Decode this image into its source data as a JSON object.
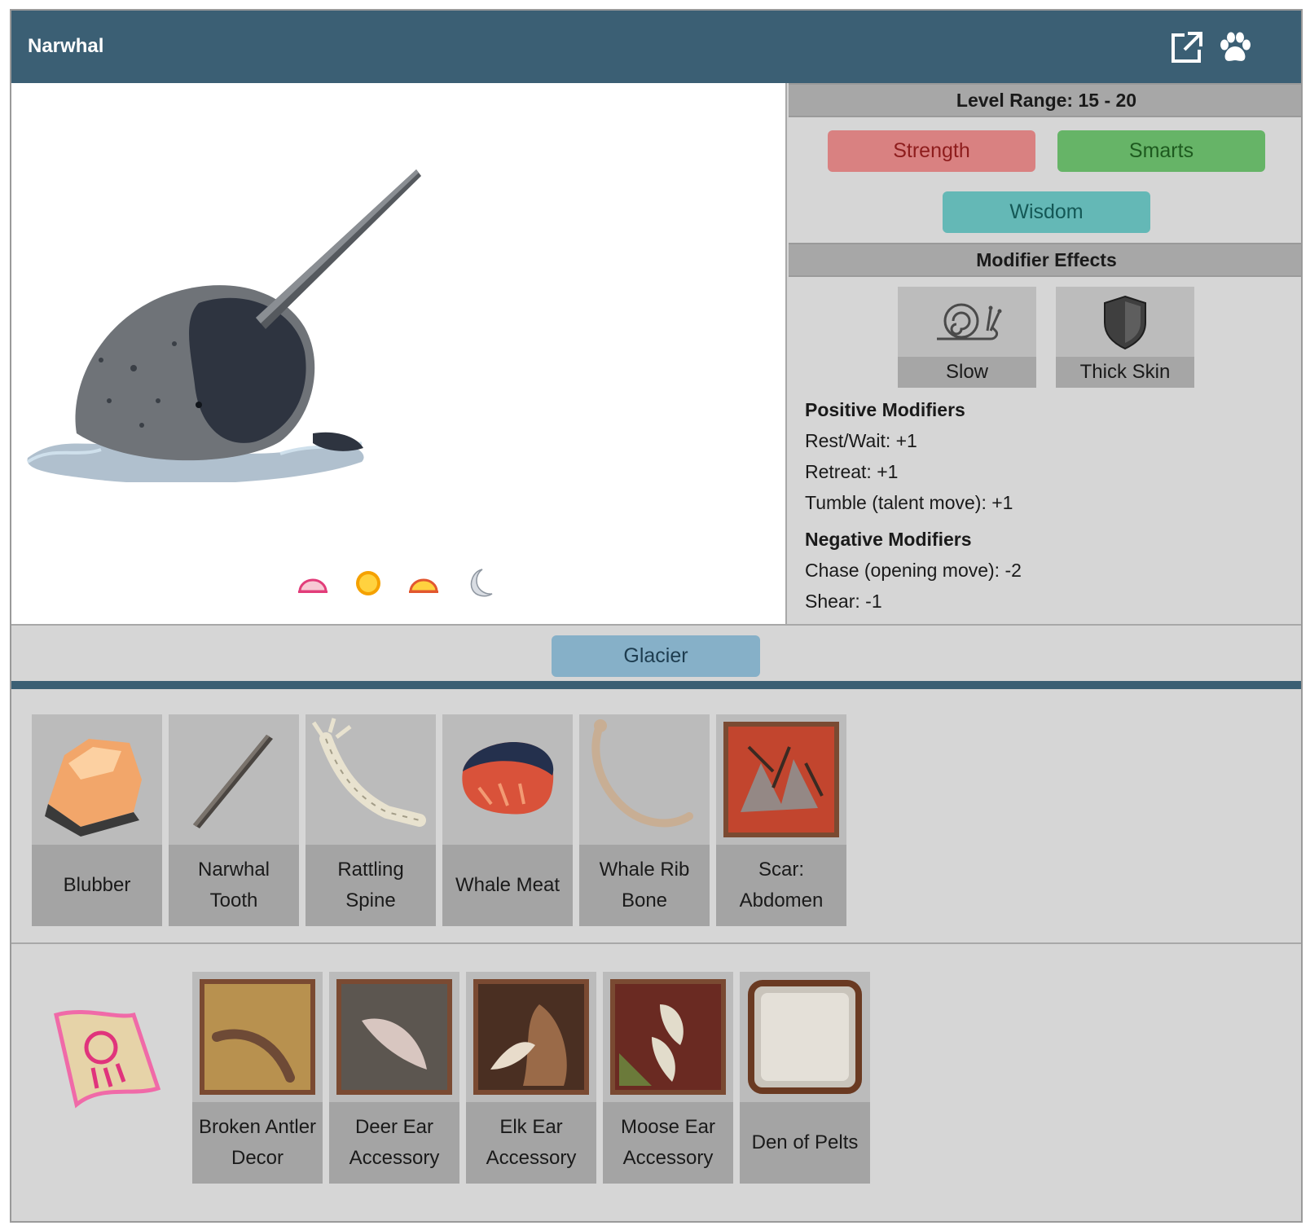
{
  "header": {
    "title": "Narwhal",
    "icons": [
      "external-link-icon",
      "paw-icon"
    ]
  },
  "times": [
    "dawn-icon",
    "day-icon",
    "dusk-icon",
    "night-icon"
  ],
  "level": {
    "label": "Level Range: 15 - 20"
  },
  "stats": {
    "strength": "Strength",
    "smarts": "Smarts",
    "wisdom": "Wisdom"
  },
  "modifier_effects": {
    "heading": "Modifier Effects",
    "effects": [
      {
        "label": "Slow",
        "icon": "snail-icon"
      },
      {
        "label": "Thick Skin",
        "icon": "shield-icon"
      }
    ],
    "positive_heading": "Positive Modifiers",
    "positive": [
      "Rest/Wait: +1",
      "Retreat: +1",
      "Tumble (talent move): +1"
    ],
    "negative_heading": "Negative Modifiers",
    "negative": [
      "Chase (opening move): -2",
      "Shear: -1"
    ]
  },
  "habitat": {
    "label": "Glacier"
  },
  "drops": [
    "Blubber",
    "Narwhal Tooth",
    "Rattling Spine",
    "Whale Meat",
    "Whale Rib Bone",
    "Scar: Abdomen"
  ],
  "rewards": [
    "Broken Antler Decor",
    "Deer Ear Accessory",
    "Elk Ear Accessory",
    "Moose Ear Accessory",
    "Den of Pelts"
  ],
  "colors": {
    "header": "#3b5f74",
    "strength": "#d98181",
    "smarts": "#66b467",
    "wisdom": "#64b8b6",
    "habitat": "#86b0c8"
  }
}
